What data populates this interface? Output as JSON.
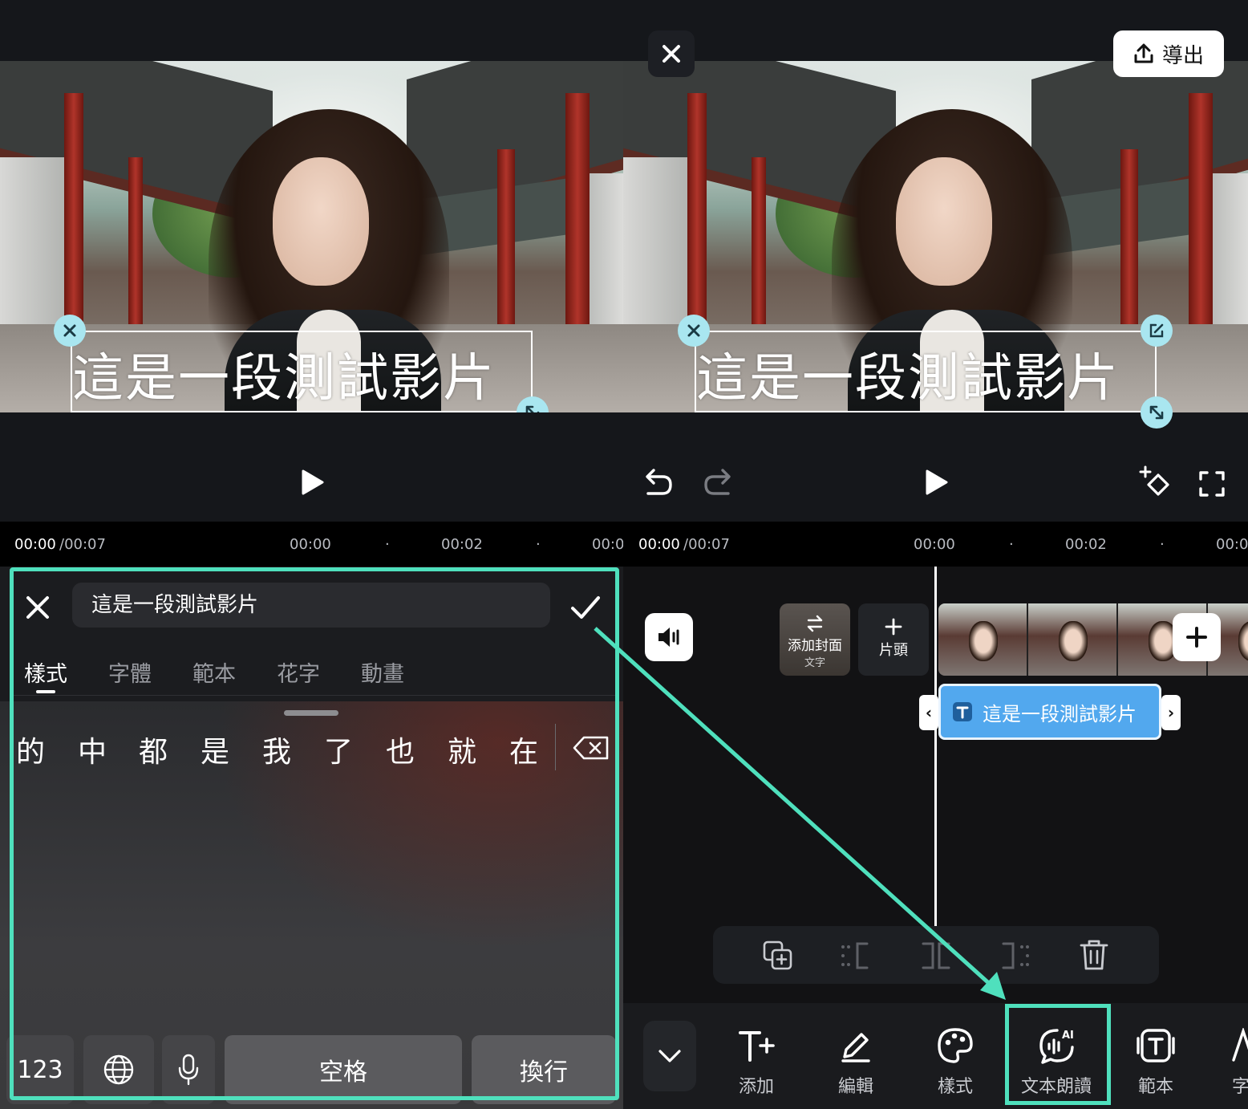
{
  "left_panel": {
    "caption": "這是一段測試影片",
    "time_current": "00:00",
    "time_total": "/00:07",
    "ruler_ticks": [
      "00:00",
      "00:02",
      "00:0"
    ],
    "text_input_value": "這是一段測試影片",
    "tabs": [
      "樣式",
      "字體",
      "範本",
      "花字",
      "動畫"
    ],
    "active_tab_index": 0,
    "candidates": [
      "的",
      "中",
      "都",
      "是",
      "我",
      "了",
      "也",
      "就",
      "在"
    ],
    "keys": {
      "numbers": "123",
      "space": "空格",
      "enter": "換行"
    }
  },
  "right_panel": {
    "caption": "這是一段測試影片",
    "export_label": "導出",
    "time_current": "00:00",
    "time_total": "/00:07",
    "ruler_ticks": [
      "00:00",
      "00:02",
      "00:0"
    ],
    "cover_label": "添加封面",
    "cover_sub": "文字",
    "opening_label": "片頭",
    "text_clip_label": "這是一段測試影片",
    "toolbar": [
      {
        "label": "添加",
        "icon": "add-text-icon"
      },
      {
        "label": "編輯",
        "icon": "pencil-icon"
      },
      {
        "label": "樣式",
        "icon": "palette-icon"
      },
      {
        "label": "文本朗讀",
        "icon": "ai-voice-icon"
      },
      {
        "label": "範本",
        "icon": "template-icon"
      },
      {
        "label": "字",
        "icon": "text-icon"
      }
    ]
  },
  "colors": {
    "highlight": "#4fe0bd",
    "clip_blue": "#52a8ee",
    "handle": "#a9e6f0"
  }
}
